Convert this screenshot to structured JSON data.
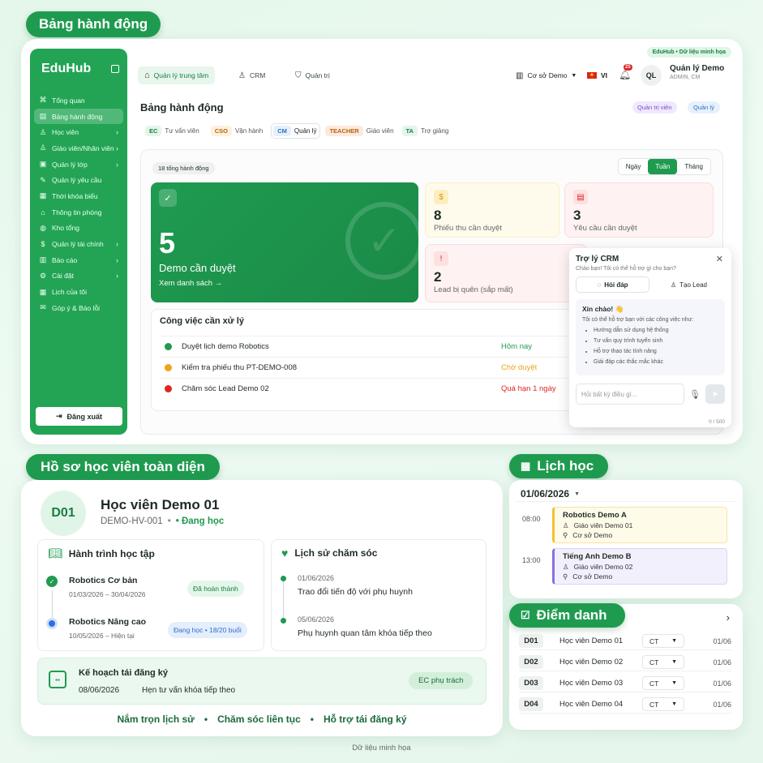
{
  "sections": {
    "actions": "Bảng hành động",
    "profile": "Hồ sơ học viên toàn diện",
    "schedule": "Lịch học",
    "attendance": "Điểm danh"
  },
  "tag_demo": "EduHub • Dữ liệu minh họa",
  "sidebar": {
    "logo": "EduHub",
    "items": [
      {
        "icon": "⌘",
        "label": "Tổng quan",
        "chev": false
      },
      {
        "icon": "▤",
        "label": "Bảng hành động",
        "chev": false,
        "active": true
      },
      {
        "icon": "♙",
        "label": "Học viên",
        "chev": true
      },
      {
        "icon": "♙",
        "label": "Giáo viên/Nhân viên",
        "chev": true
      },
      {
        "icon": "▣",
        "label": "Quản lý lớp",
        "chev": true
      },
      {
        "icon": "✎",
        "label": "Quản lý yêu cầu",
        "chev": false
      },
      {
        "icon": "▦",
        "label": "Thời khóa biểu",
        "chev": false
      },
      {
        "icon": "⌂",
        "label": "Thông tin phòng",
        "chev": false
      },
      {
        "icon": "◍",
        "label": "Kho tổng",
        "chev": false
      },
      {
        "icon": "$",
        "label": "Quản lý tài chính",
        "chev": true
      },
      {
        "icon": "▥",
        "label": "Báo cáo",
        "chev": true
      },
      {
        "icon": "⚙",
        "label": "Cài đặt",
        "chev": true
      },
      {
        "icon": "▦",
        "label": "Lịch của tôi",
        "chev": false
      },
      {
        "icon": "✉",
        "label": "Góp ý & Báo lỗi",
        "chev": false
      }
    ],
    "logout": "Đăng xuất"
  },
  "topnav": {
    "tabs": [
      "Quản lý trung tâm",
      "CRM",
      "Quản trị"
    ],
    "branch": "Cơ sở Demo",
    "lang": "VI",
    "notif": "25",
    "avatar": "QL",
    "user_name": "Quản lý Demo",
    "user_role": "ADMIN, CM"
  },
  "page": {
    "title": "Bảng hành động",
    "chips": [
      "Quản trị viên",
      "Quản lý"
    ],
    "roles": [
      {
        "code": "EC",
        "label": "Tư vấn viên"
      },
      {
        "code": "CSO",
        "label": "Vận hành"
      },
      {
        "code": "CM",
        "label": "Quản lý"
      },
      {
        "code": "TEACHER",
        "label": "Giáo viên"
      },
      {
        "code": "TA",
        "label": "Trợ giảng"
      }
    ],
    "total": "18 tổng hành động",
    "periods": [
      "Ngày",
      "Tuần",
      "Tháng"
    ]
  },
  "stats": {
    "big": {
      "value": "5",
      "label": "Demo cần duyệt",
      "link": "Xem danh sách →"
    },
    "receipts": {
      "value": "8",
      "label": "Phiếu thu cần duyệt"
    },
    "requests": {
      "value": "3",
      "label": "Yêu cầu cần duyệt"
    },
    "leads": {
      "value": "2",
      "label": "Lead bị quên (sắp mất)"
    }
  },
  "tasks": {
    "title": "Công việc cần xử lý",
    "rows": [
      {
        "text": "Duyệt lịch demo Robotics",
        "status": "Hôm nay",
        "color": "#1f9b50"
      },
      {
        "text": "Kiểm tra phiếu thu PT-DEMO-008",
        "status": "Chờ duyệt",
        "color": "#f0a21a"
      },
      {
        "text": "Chăm sóc Lead Demo 02",
        "status": "Quá hạn 1 ngày",
        "color": "#e02424"
      }
    ]
  },
  "assistant": {
    "title": "Trợ lý CRM",
    "subtitle": "Chào bạn! Tôi có thể hỗ trợ gì cho bạn?",
    "tab1": "Hỏi đáp",
    "tab2": "Tạo Lead",
    "hello": "Xin chào! 👋",
    "intro": "Tôi có thể hỗ trợ bạn với các công việc như:",
    "bullets": [
      "Hướng dẫn sử dụng hệ thống",
      "Tư vấn quy trình tuyển sinh",
      "Hỗ trợ thao tác tính năng",
      "Giải đáp các thắc mắc khác"
    ],
    "placeholder": "Hỏi bất kỳ điều gì...",
    "counter": "0 / 500"
  },
  "student": {
    "initials": "D01",
    "name": "Học viên Demo 01",
    "code": "DEMO-HV-001",
    "sep": "•",
    "status": "• Đang học",
    "journey_title": "Hành trình học tập",
    "journey": [
      {
        "course": "Robotics Cơ bản",
        "dates": "01/03/2026 – 30/04/2026",
        "badge": "Đã hoàn thành"
      },
      {
        "course": "Robotics Nâng cao",
        "dates": "10/05/2026 – Hiện tại",
        "badge": "Đang học • 18/20 buổi"
      }
    ],
    "care_title": "Lịch sử chăm sóc",
    "care": [
      {
        "date": "01/06/2026",
        "text": "Trao đổi tiến độ với phụ huynh"
      },
      {
        "date": "05/06/2026",
        "text": "Phụ huynh quan tâm khóa tiếp theo"
      }
    ],
    "reenroll_title": "Kế hoạch tái đăng ký",
    "reenroll_date": "08/06/2026",
    "reenroll_text": "Hẹn tư vấn khóa tiếp theo",
    "reenroll_owner": "EC phụ trách",
    "footer": [
      "Nắm trọn lịch sử",
      "Chăm sóc liên tục",
      "Hỗ trợ tái đăng ký"
    ]
  },
  "schedule": {
    "date": "01/06/2026",
    "items": [
      {
        "time": "08:00",
        "title": "Robotics Demo A",
        "teacher": "Giáo viên Demo 01",
        "place": "Cơ sở Demo",
        "color": "#f2c230",
        "bg": "#fffbe9"
      },
      {
        "time": "13:00",
        "title": "Tiếng Anh Demo B",
        "teacher": "Giáo viên Demo 02",
        "place": "Cơ sở Demo",
        "color": "#8b6fe0",
        "bg": "#f3f0fd"
      }
    ]
  },
  "attendance": {
    "rows": [
      {
        "id": "D01",
        "name": "Học viên Demo 01",
        "state": "CT",
        "date": "01/06"
      },
      {
        "id": "D02",
        "name": "Học viên Demo 02",
        "state": "CT",
        "date": "01/06"
      },
      {
        "id": "D03",
        "name": "Học viên Demo 03",
        "state": "CT",
        "date": "01/06"
      },
      {
        "id": "D04",
        "name": "Học viên Demo 04",
        "state": "CT",
        "date": "01/06"
      }
    ]
  },
  "footnote": "Dữ liệu minh họa",
  "colors": {
    "primary": "#1f9b50",
    "sidebar": "#22a454",
    "danger": "#e02424",
    "warning": "#f0a21a"
  }
}
